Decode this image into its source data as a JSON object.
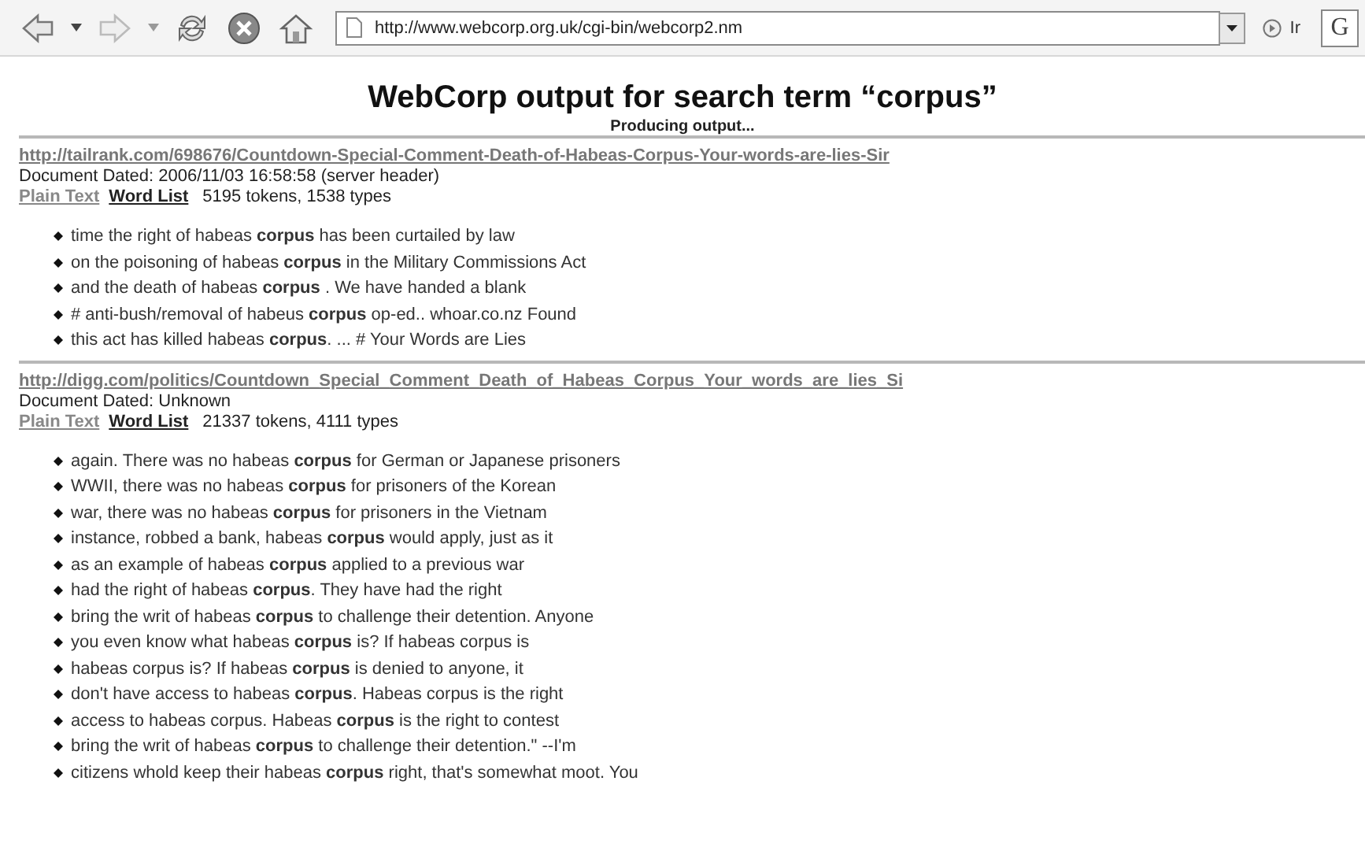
{
  "toolbar": {
    "address": "http://www.webcorp.org.uk/cgi-bin/webcorp2.nm",
    "go_label": "Ir",
    "search_engine": "G",
    "forward_disabled": true
  },
  "title": "WebCorp output for search term “corpus”",
  "status": "Producing output...",
  "results": [
    {
      "url": "http://tailrank.com/698676/Countdown-Special-Comment-Death-of-Habeas-Corpus-Your-words-are-lies-Sir",
      "dated": "Document Dated: 2006/11/03 16:58:58 (server header)",
      "links": [
        "Plain Text",
        "Word List"
      ],
      "stats": "5195 tokens, 1538 types",
      "lines": [
        "time the right of habeas **corpus** has been curtailed by law",
        "on the poisoning of habeas **corpus** in the Military Commissions Act",
        "and the death of habeas **corpus** . We have handed a blank",
        "# anti-bush/removal of habeus **corpus** op-ed.. whoar.co.nz Found",
        "this act has killed habeas **corpus**. ... # Your Words are Lies"
      ]
    },
    {
      "url": "http://digg.com/politics/Countdown_Special_Comment_Death_of_Habeas_Corpus_Your_words_are_lies_Si",
      "dated": "Document Dated: Unknown",
      "links": [
        "Plain Text",
        "Word List"
      ],
      "stats": "21337 tokens, 4111 types",
      "lines": [
        "again. There was no habeas **corpus** for German or Japanese prisoners",
        "WWII, there was no habeas **corpus** for prisoners of the Korean",
        "war, there was no habeas **corpus** for prisoners in the Vietnam",
        "instance, robbed a bank, habeas **corpus** would apply, just as it",
        "as an example of habeas **corpus** applied to a previous war",
        "had the right of habeas **corpus**. They have had the right",
        "bring the writ of habeas **corpus** to challenge their detention. Anyone",
        "you even know what habeas **corpus** is? If habeas corpus is",
        "habeas corpus is? If habeas **corpus** is denied to anyone, it",
        "don't have access to habeas **corpus**. Habeas corpus is the right",
        "access to habeas corpus. Habeas **corpus** is the right to contest",
        "bring the writ of habeas **corpus** to challenge their detention.\" --I'm",
        "citizens whold keep their habeas **corpus** right, that's somewhat moot. You"
      ]
    }
  ]
}
